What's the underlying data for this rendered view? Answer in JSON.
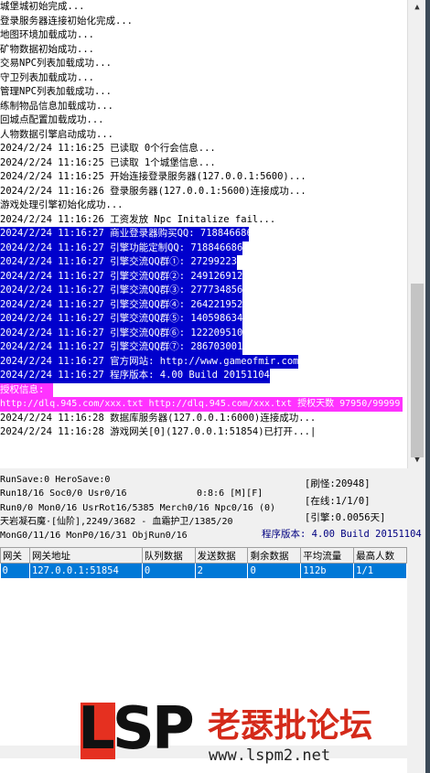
{
  "log_lines": [
    {
      "text": "城堡城初始完成...",
      "style": ""
    },
    {
      "text": "登录服务器连接初始化完成...",
      "style": ""
    },
    {
      "text": "地图环境加载成功...",
      "style": ""
    },
    {
      "text": "矿物数据初始成功...",
      "style": ""
    },
    {
      "text": "交易NPC列表加载成功...",
      "style": ""
    },
    {
      "text": "守卫列表加载成功...",
      "style": ""
    },
    {
      "text": "管理NPC列表加载成功...",
      "style": ""
    },
    {
      "text": "练制物品信息加载成功...",
      "style": ""
    },
    {
      "text": "回城点配置加载成功...",
      "style": ""
    },
    {
      "text": "人物数据引擎启动成功...",
      "style": ""
    },
    {
      "text": "2024/2/24 11:16:25 已读取 0个行会信息...",
      "style": ""
    },
    {
      "text": "2024/2/24 11:16:25 已读取 1个城堡信息...",
      "style": ""
    },
    {
      "text": "2024/2/24 11:16:25 开始连接登录服务器(127.0.0.1:5600)...",
      "style": ""
    },
    {
      "text": "2024/2/24 11:16:26 登录服务器(127.0.0.1:5600)连接成功...",
      "style": ""
    },
    {
      "text": "游戏处理引擎初始化成功...",
      "style": ""
    },
    {
      "text": "2024/2/24 11:16:26 工资发放 Npc Initalize fail...",
      "style": ""
    },
    {
      "text": "2024/2/24 11:16:27 商业登录器购买QQ: 718846686",
      "style": "blue-full"
    },
    {
      "text": "2024/2/24 11:16:27 引擎功能定制QQ: 718846686",
      "style": "blue"
    },
    {
      "text": "2024/2/24 11:16:27 引擎交流QQ群①: 27299223",
      "style": "blue"
    },
    {
      "text": "2024/2/24 11:16:27 引擎交流QQ群②: 249126912",
      "style": "blue"
    },
    {
      "text": "2024/2/24 11:16:27 引擎交流QQ群③: 277734856",
      "style": "blue"
    },
    {
      "text": "2024/2/24 11:16:27 引擎交流QQ群④: 264221952",
      "style": "blue"
    },
    {
      "text": "2024/2/24 11:16:27 引擎交流QQ群⑤: 140598634",
      "style": "blue"
    },
    {
      "text": "2024/2/24 11:16:27 引擎交流QQ群⑥: 122209510",
      "style": "blue"
    },
    {
      "text": "2024/2/24 11:16:27 引擎交流QQ群⑦: 286703001",
      "style": "blue"
    },
    {
      "text": "2024/2/24 11:16:27 官方网站: http://www.gameofmir.com",
      "style": "blue"
    },
    {
      "text": "2024/2/24 11:16:27 程序版本: 4.00 Build 20151104",
      "style": "blue"
    },
    {
      "text": "授权信息:",
      "style": "magenta-short"
    },
    {
      "text": "http://dlq.945.com/xxx.txt http://dlq.945.com/xxx.txt 授权天数 97950/99999",
      "style": "magenta"
    },
    {
      "text": "2024/2/24 11:16:28 数据库服务器(127.0.0.1:6000)连接成功...",
      "style": ""
    },
    {
      "text": "2024/2/24 11:16:28 游戏网关[0](127.0.0.1:51854)已打开...|",
      "style": ""
    }
  ],
  "stats": {
    "line1": "RunSave:0 HeroSave:0",
    "line2": "Run18/16 Soc0/0 Usr0/16",
    "line2b": "0:8:6 [M][F]",
    "line3": "Run0/0 Mon0/16 UsrRot16/5385 Merch0/16 Npc0/16 (0)",
    "line4": "天岩凝石魔·[仙阶],2249/3682 - 血霜护卫/1385/20",
    "line5": "MonG0/11/16 MonP0/16/31 ObjRun0/16",
    "monster_refresh": "[刷怪:20948]",
    "online": "[在线:1/1/0]",
    "engine": "[引擎:0.0056天]",
    "version": "程序版本: 4.00 Build 20151104"
  },
  "gateway_table": {
    "headers": [
      "网关",
      "网关地址",
      "队列数据",
      "发送数据",
      "剩余数据",
      "平均流量",
      "最高人数"
    ],
    "rows": [
      [
        "0",
        "127.0.0.1:51854",
        "0",
        "2",
        "0",
        "112b",
        "1/1"
      ]
    ]
  },
  "watermark": {
    "logo_text": "LSP",
    "cn_text": "老瑟批论坛",
    "url": "www.lspm2.net"
  }
}
